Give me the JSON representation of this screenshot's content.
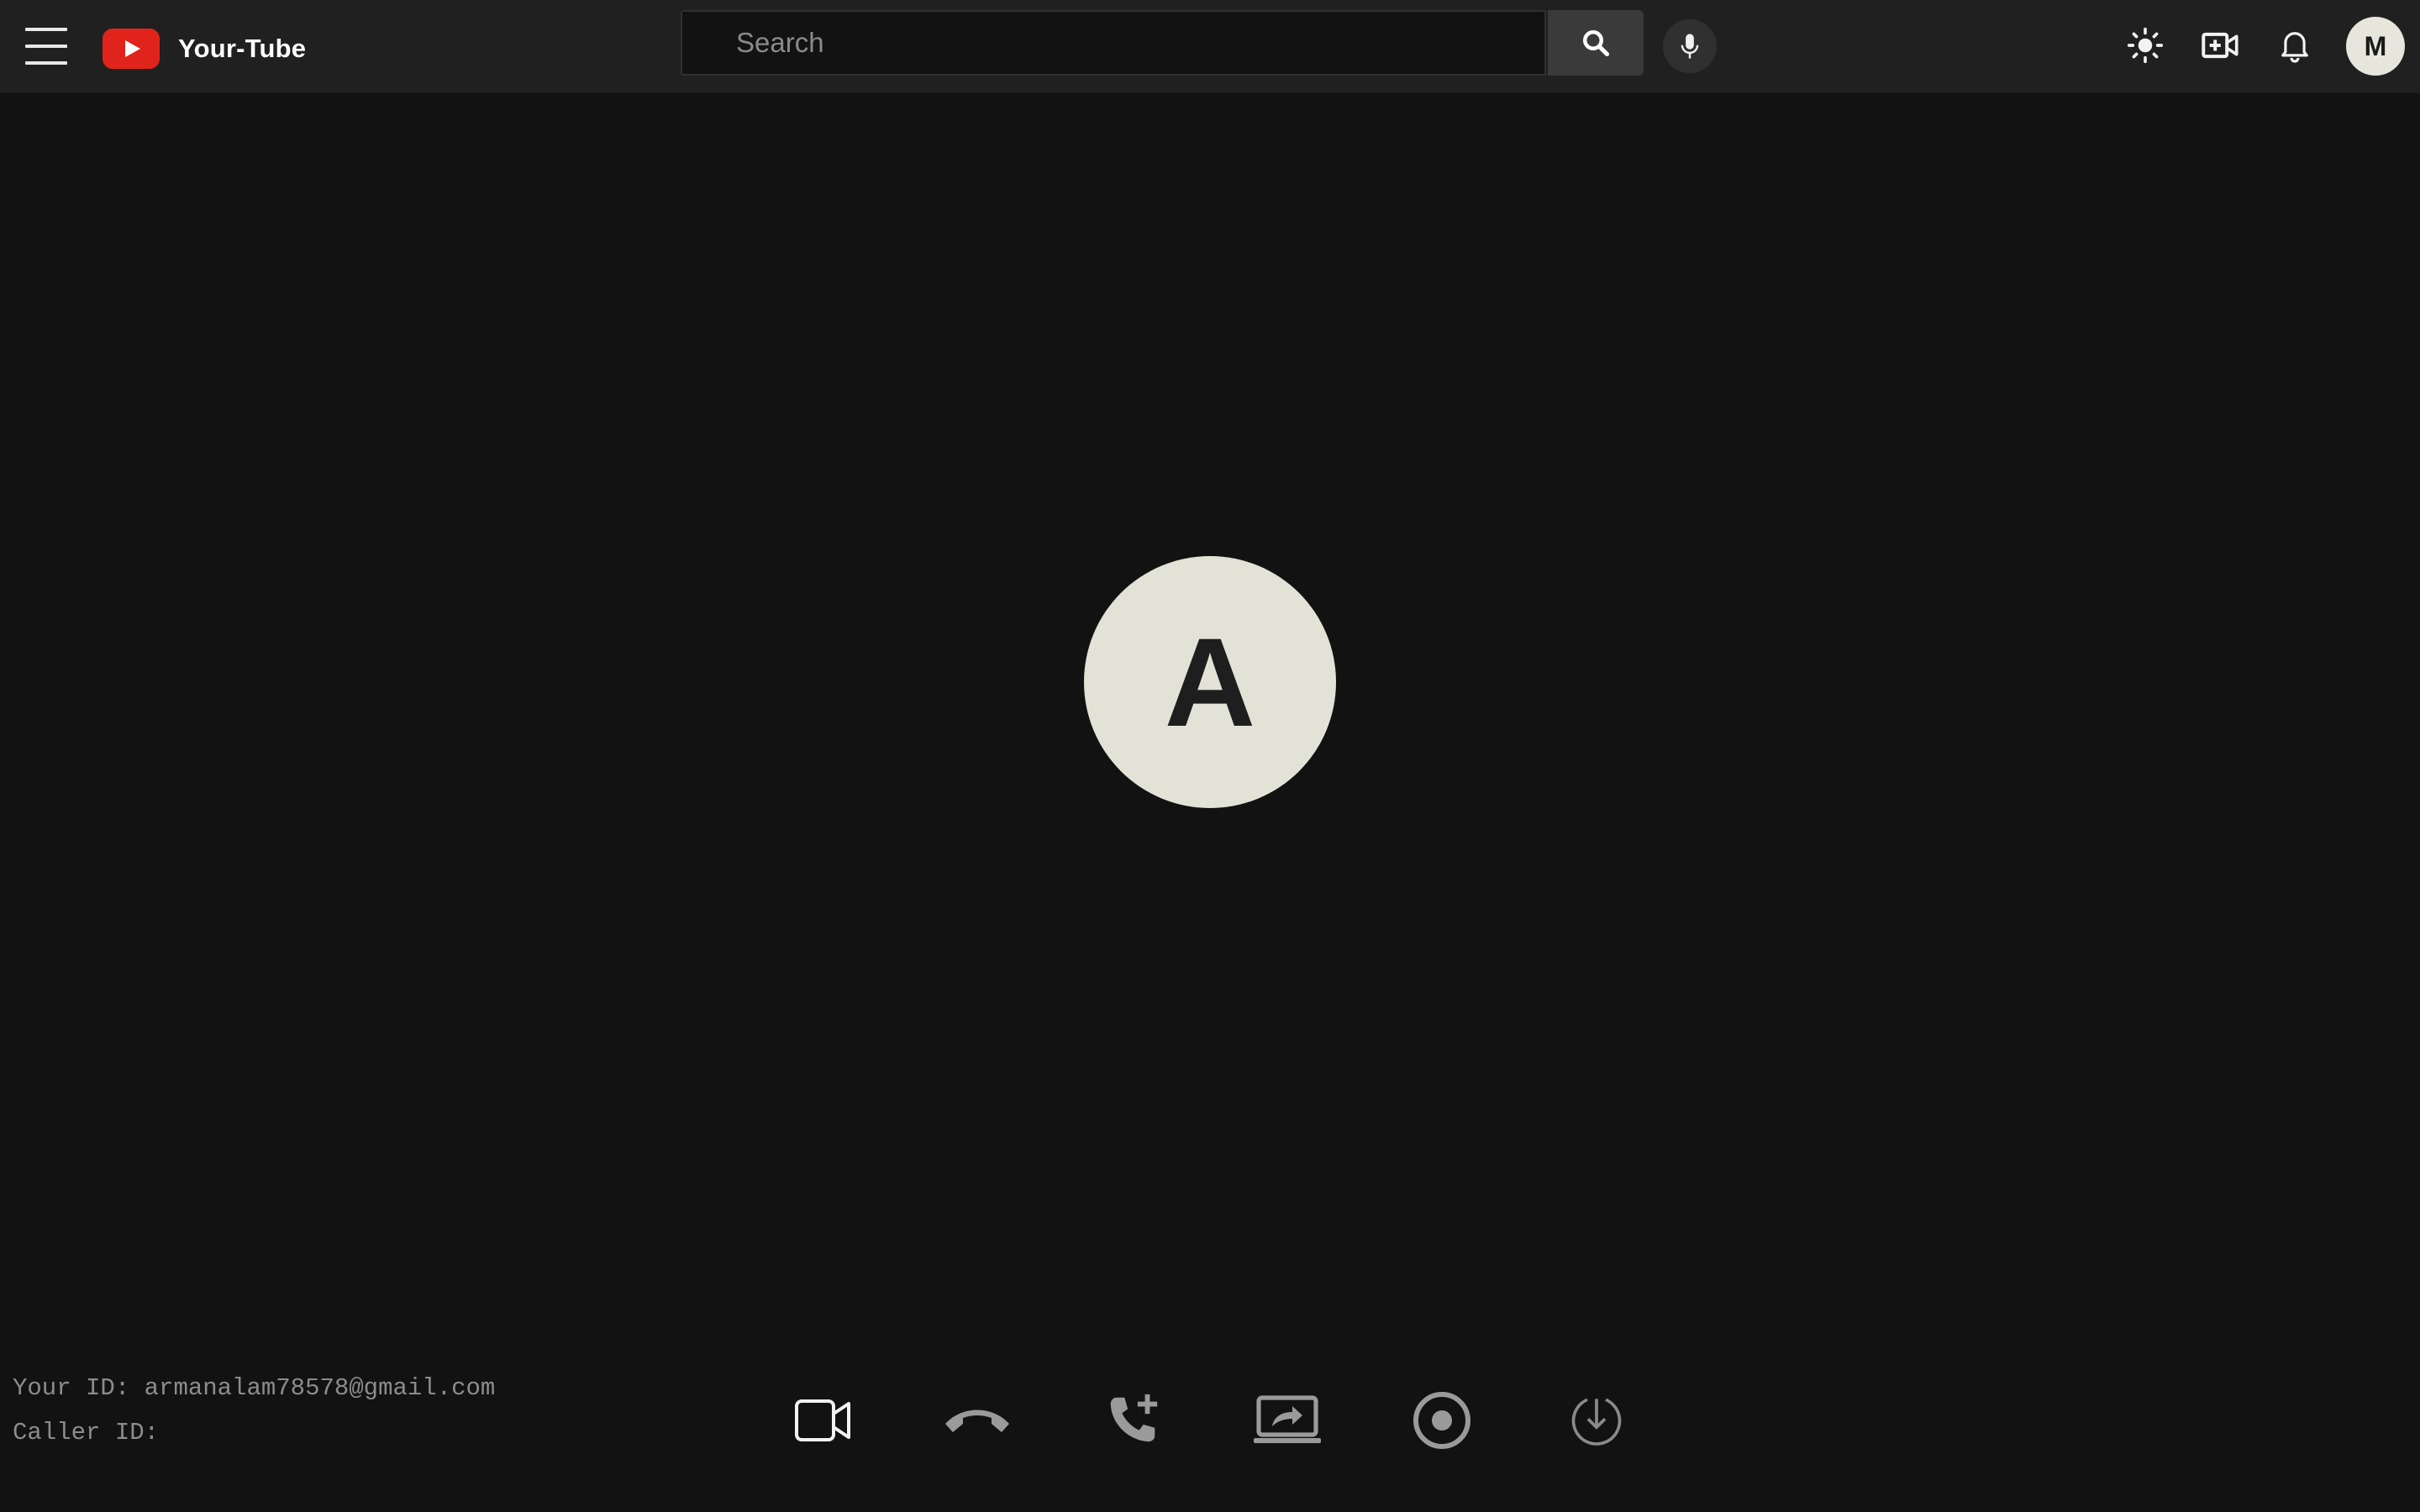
{
  "header": {
    "app_name": "Your-Tube",
    "search": {
      "placeholder": "Search",
      "value": ""
    },
    "avatar_initial": "M",
    "icons": [
      "menu-icon",
      "play-logo-icon",
      "search-icon",
      "mic-icon",
      "theme-sun-icon",
      "create-video-icon",
      "bell-icon"
    ]
  },
  "call": {
    "callee_initial": "A",
    "your_id_label": "Your ID:",
    "your_id_value": "armanalam78578@gmail.com",
    "caller_id_label": "Caller ID:",
    "caller_id_value": ""
  },
  "controls": [
    "video-camera-icon",
    "hang-up-icon",
    "add-call-icon",
    "screen-share-icon",
    "record-icon",
    "download-icon"
  ],
  "colors": {
    "background": "#121212",
    "header": "#202020",
    "brand_red": "#e0241b",
    "avatar_bg": "#e2e2d6",
    "muted_text": "#8c8c8c"
  }
}
